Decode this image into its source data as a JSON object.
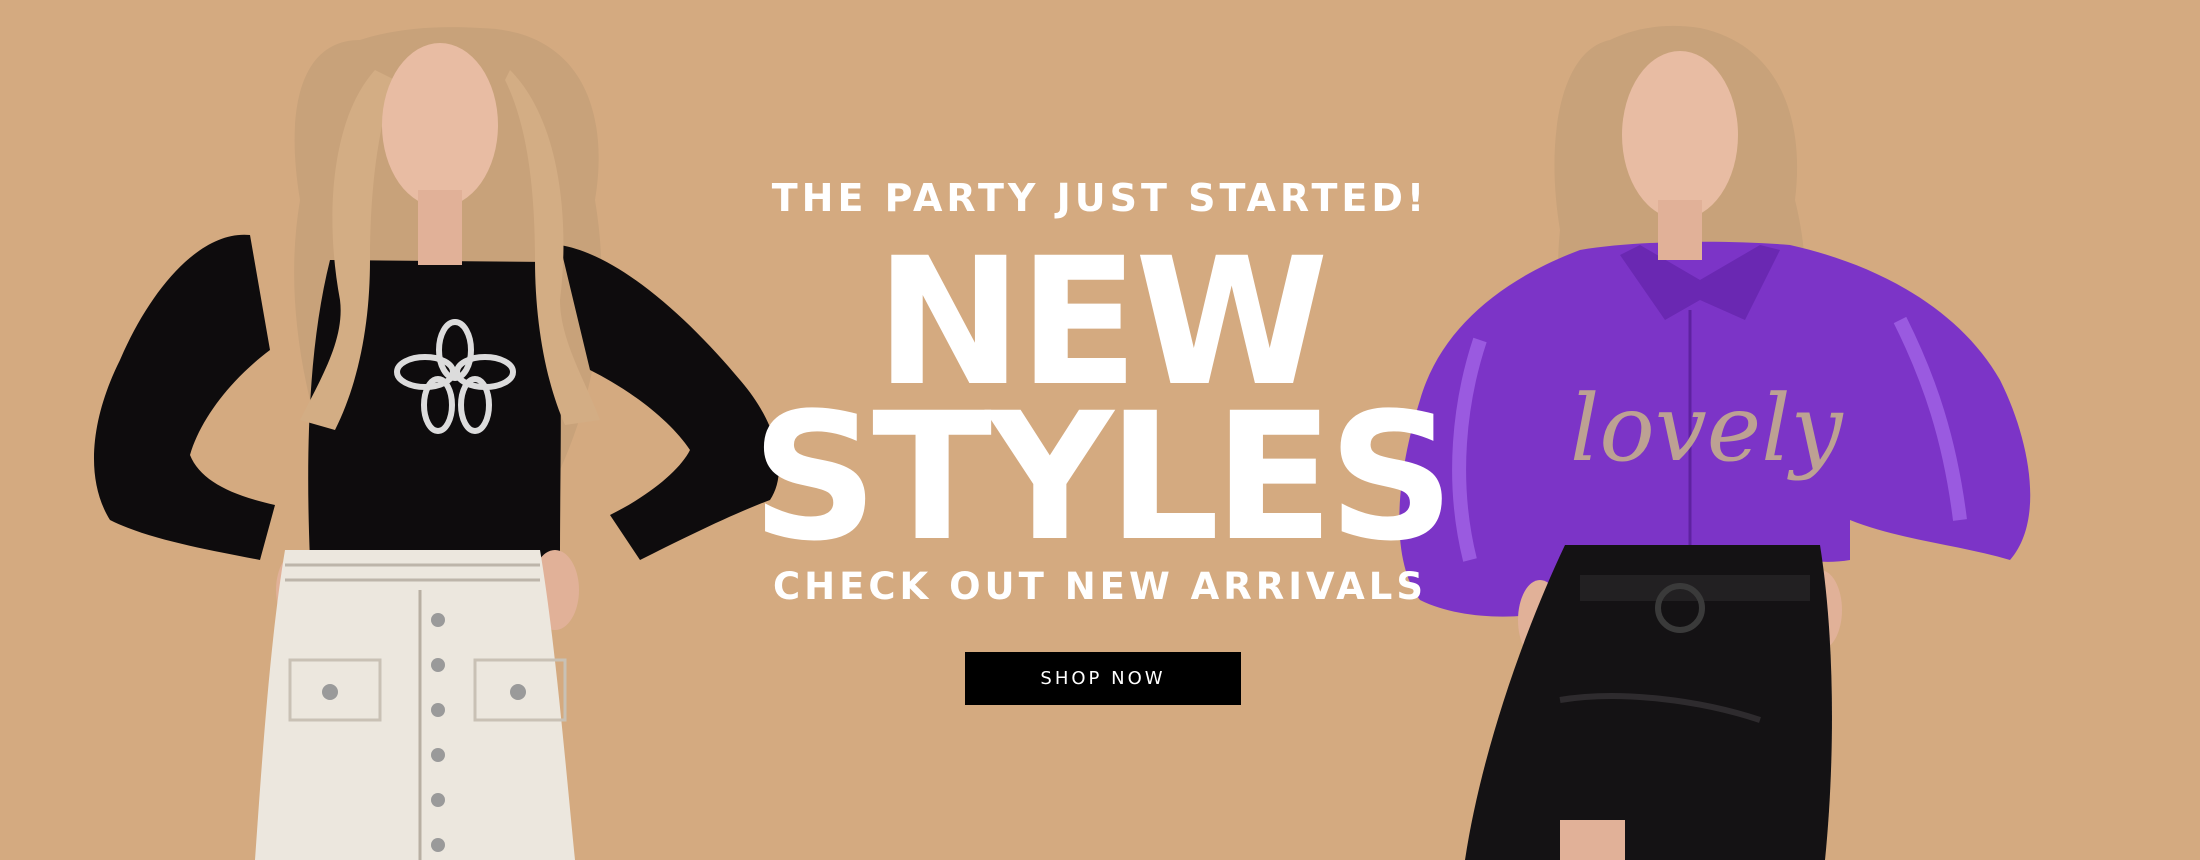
{
  "colors": {
    "background": "#d4aa80",
    "text": "#ffffff",
    "button_background": "#000000",
    "left_top": "#0e0c0d",
    "left_skirt": "#ece7de",
    "right_shirt": "#7c34c7",
    "right_shorts": "#141214",
    "hair": "#c8a27a",
    "skin": "#e8bca3"
  },
  "banner": {
    "tagline": "THE PARTY JUST STARTED!",
    "headline_line1": "NEW",
    "headline_line2": "STYLES",
    "subline": "CHECK OUT NEW ARRIVALS",
    "cta_label": "SHOP NOW"
  },
  "images": {
    "left_model": "model-black-organza-top-white-skirt",
    "right_model": "model-purple-satin-shirt-black-shorts",
    "right_shirt_print": "lovely"
  }
}
